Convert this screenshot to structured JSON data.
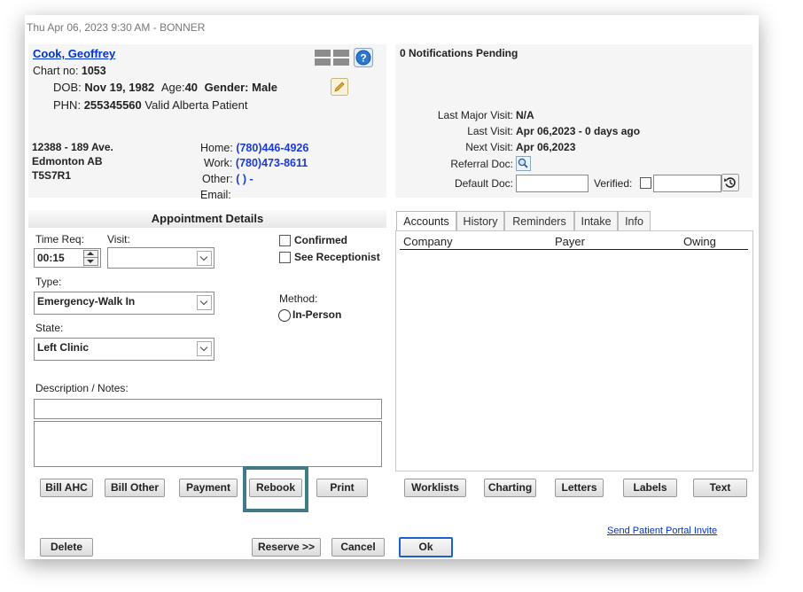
{
  "window": {
    "title": "Thu Apr 06, 2023  9:30 AM - BONNER"
  },
  "patient": {
    "name": "Cook, Geoffrey",
    "chart_label": "Chart no:",
    "chart_no": "1053",
    "dob_label": "DOB:",
    "dob": "Nov 19, 1982",
    "age_label": "Age:",
    "age": "40",
    "gender_label": "Gender:",
    "gender": "Male",
    "phn_label": "PHN:",
    "phn": "255345560",
    "phn_status": "Valid Alberta Patient",
    "address_line1": "12388 - 189 Ave.",
    "address_line2": "Edmonton  AB",
    "address_line3": "T5S7R1",
    "home_label": "Home:",
    "home_phone": "(780)446-4926",
    "work_label": "Work:",
    "work_phone": "(780)473-8611",
    "other_label": "Other:",
    "other_phone": "(  )  -",
    "email_label": "Email:",
    "email": ""
  },
  "notifications": {
    "text": "0 Notifications Pending"
  },
  "visits": {
    "last_major_label": "Last Major Visit:",
    "last_major": "N/A",
    "last_visit_label": "Last Visit:",
    "last_visit": "Apr 06,2023 - 0 days ago",
    "next_visit_label": "Next Visit:",
    "next_visit": "Apr 06,2023",
    "referral_label": "Referral Doc:",
    "default_doc_label": "Default Doc:",
    "default_doc_value": "",
    "verified_label": "Verified:",
    "verified_value": ""
  },
  "appointment": {
    "header": "Appointment Details",
    "time_req_label": "Time Req:",
    "time_req": "00:15",
    "visit_label": "Visit:",
    "visit_value": "",
    "confirmed_label": "Confirmed",
    "see_receptionist_label": "See Receptionist",
    "type_label": "Type:",
    "type_value": "Emergency-Walk In",
    "method_label": "Method:",
    "method_option": "In-Person",
    "state_label": "State:",
    "state_value": "Left Clinic",
    "notes_label": "Description / Notes:",
    "description": "",
    "notes": ""
  },
  "tabs": [
    {
      "label": "Accounts"
    },
    {
      "label": "History"
    },
    {
      "label": "Reminders"
    },
    {
      "label": "Intake"
    },
    {
      "label": "Info"
    }
  ],
  "accounts_table": {
    "columns": [
      "Company",
      "Payer",
      "Owing"
    ]
  },
  "buttons": {
    "bill_ahc": "Bill AHC",
    "bill_other": "Bill Other",
    "payment": "Payment",
    "rebook": "Rebook",
    "print": "Print",
    "worklists": "Worklists",
    "charting": "Charting",
    "letters": "Letters",
    "labels": "Labels",
    "text": "Text",
    "delete": "Delete",
    "reserve": "Reserve >>",
    "cancel": "Cancel",
    "ok": "Ok"
  },
  "portal_link": "Send Patient Portal Invite",
  "colors": {
    "highlight": "#3f7a86",
    "link": "#0033cc",
    "ok_border": "#1c5fd1"
  }
}
